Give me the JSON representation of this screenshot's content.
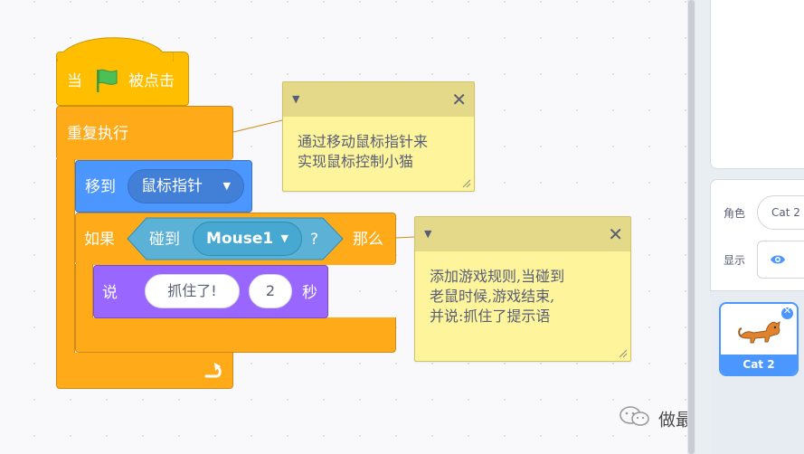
{
  "blocks": {
    "when_flag": {
      "before": "当",
      "after": "被点击"
    },
    "forever": {
      "label": "重复执行"
    },
    "goto": {
      "label": "移到",
      "target": "鼠标指针"
    },
    "if_block": {
      "if_label": "如果",
      "then_label": "那么"
    },
    "touching": {
      "label": "碰到",
      "target": "Mouse1",
      "question": "?"
    },
    "say": {
      "label": "说",
      "message": "抓住了!",
      "seconds": "2",
      "unit": "秒"
    }
  },
  "comments": [
    {
      "lines": [
        "通过移动鼠标指针来",
        "实现鼠标控制小猫"
      ]
    },
    {
      "lines": [
        "添加游戏规则,当碰到",
        "老鼠时候,游戏结束,",
        "并说:抓住了提示语"
      ]
    }
  ],
  "sprite_info": {
    "sprite_label": "角色",
    "sprite_name": "Cat 2",
    "show_label": "显示"
  },
  "sprite_list": [
    {
      "name": "Cat 2"
    }
  ],
  "watermark": {
    "text": "做最好的自己"
  },
  "colors": {
    "events": "#ffbf00",
    "control": "#ffab19",
    "motion": "#4c97ff",
    "looks": "#9966ff",
    "sensing": "#5cb1d6",
    "comment": "#fef49c",
    "flag": "#4cbf56"
  }
}
